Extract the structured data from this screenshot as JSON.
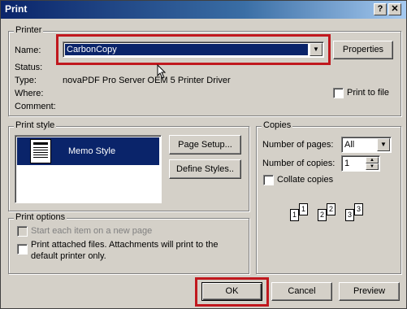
{
  "window": {
    "title": "Print",
    "help_label": "?",
    "close_label": "✕"
  },
  "printer": {
    "group_label": "Printer",
    "name_label": "Name:",
    "name_value": "CarbonCopy",
    "status_label": "Status:",
    "type_label": "Type:",
    "type_value": "novaPDF Pro Server OEM 5 Printer Driver",
    "where_label": "Where:",
    "comment_label": "Comment:",
    "properties_button": "Properties",
    "print_to_file_label": "Print to file"
  },
  "print_style": {
    "group_label": "Print style",
    "selected_style": "Memo Style",
    "page_setup_button": "Page Setup...",
    "define_styles_button": "Define Styles.."
  },
  "copies": {
    "group_label": "Copies",
    "number_of_pages_label": "Number of pages:",
    "number_of_pages_value": "All",
    "number_of_copies_label": "Number of copies:",
    "number_of_copies_value": "1",
    "collate_label": "Collate copies",
    "page_numbers": [
      "1",
      "1",
      "2",
      "2",
      "3",
      "3"
    ]
  },
  "print_options": {
    "group_label": "Print options",
    "start_each_item_label": "Start each item on a new page",
    "print_attached_label": "Print attached files.  Attachments will print to the default printer only."
  },
  "footer": {
    "ok_button": "OK",
    "cancel_button": "Cancel",
    "preview_button": "Preview"
  },
  "colors": {
    "highlight": "#c0181e",
    "selection": "#0a246a",
    "face": "#d4d0c8"
  }
}
